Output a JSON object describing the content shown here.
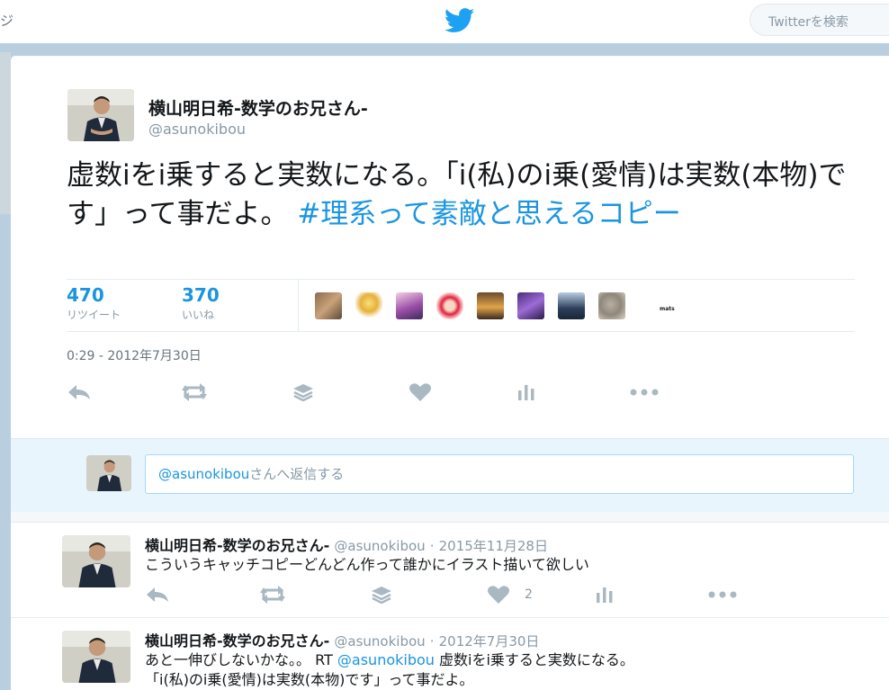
{
  "topbar": {
    "nav_fragment": "ジ",
    "search_placeholder": "Twitterを検索"
  },
  "tweet": {
    "author_name": "横山明日希-数学のお兄さん-",
    "author_handle": "@asunokibou",
    "text": "虚数iをi乗すると実数になる。「i(私)のi乗(愛情)は実数(本物)です」って事だよ。",
    "hashtag": "#理系って素敵と思えるコピー",
    "retweets_count": "470",
    "retweets_label": "リツイート",
    "likes_count": "370",
    "likes_label": "いいね",
    "likers_more": "mats",
    "timestamp": "0:29 - 2012年7月30日"
  },
  "reply_box": {
    "mention": "@asunokibou",
    "placeholder_rest": "さんへ返信する"
  },
  "replies": [
    {
      "name": "横山明日希-数学のお兄さん-",
      "handle": "@asunokibou",
      "separator": "·",
      "date": "2015年11月28日",
      "text": "こういうキャッチコピーどんどん作って誰かにイラスト描いて欲しい",
      "like_count": "2"
    },
    {
      "name": "横山明日希-数学のお兄さん-",
      "handle": "@asunokibou",
      "separator": "·",
      "date": "2012年7月30日",
      "text_prefix": "あと一伸びしないかな。。 RT ",
      "mention": "@asunokibou",
      "text_suffix": " 虚数iをi乗すると実数になる。",
      "text_line2": "「i(私)のi乗(愛情)は実数(本物)です」って事だよ。"
    }
  ],
  "colors": {
    "accent": "#1b95e0",
    "muted": "#8899a6",
    "icon": "#aab8c2",
    "backdrop": "#b9cfe0"
  },
  "icons": {
    "logo": "twitter-bird-icon",
    "reply": "reply-icon",
    "retweet": "retweet-icon",
    "stack": "stack-icon",
    "like": "heart-icon",
    "analytics": "analytics-icon",
    "more": "more-dots-icon"
  }
}
